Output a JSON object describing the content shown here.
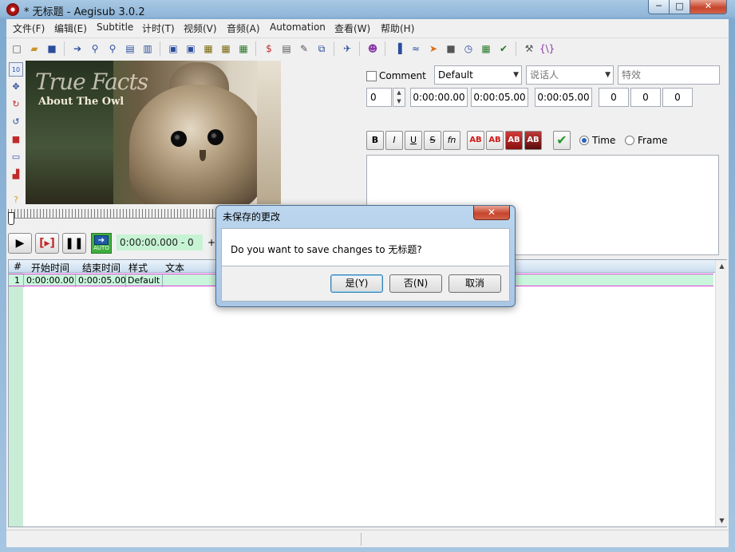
{
  "window": {
    "title": "* 无标题 - Aegisub 3.0.2",
    "min_glyph": "─",
    "max_glyph": "□",
    "close_glyph": "✕"
  },
  "menu": [
    "文件(F)",
    "编辑(E)",
    "Subtitle",
    "计时(T)",
    "视频(V)",
    "音频(A)",
    "Automation",
    "查看(W)",
    "帮助(H)"
  ],
  "video": {
    "title": "True Facts",
    "subtitle": "About The Owl"
  },
  "playback": {
    "time": "0:00:00.000 - 0",
    "auto_label": "AUTO",
    "plus_label": "+"
  },
  "edit": {
    "comment_label": "Comment",
    "style_value": "Default",
    "actor_placeholder": "说话人",
    "effect_placeholder": "特效",
    "layer_value": "0",
    "start_time": "0:00:00.00",
    "end_time": "0:00:05.00",
    "duration": "0:00:05.00",
    "margin_l": "0",
    "margin_r": "0",
    "margin_v": "0",
    "bold": "B",
    "italic": "I",
    "underline": "U",
    "strike": "S",
    "fn": "fn",
    "color_labels": [
      "AB",
      "AB",
      "AB",
      "AB"
    ],
    "time_label": "Time",
    "frame_label": "Frame"
  },
  "grid": {
    "headers": [
      "#",
      "开始时间",
      "结束时间",
      "样式",
      "文本"
    ],
    "rows": [
      {
        "num": "1",
        "start": "0:00:00.00",
        "end": "0:00:05.00",
        "style": "Default",
        "text": ""
      }
    ]
  },
  "dialog": {
    "title": "未保存的更改",
    "message": "Do you want to save changes to 无标题?",
    "yes_label": "是(Y)",
    "no_label": "否(N)",
    "cancel_label": "取消"
  },
  "colors": {
    "time_field_bg": "#c6f3d3",
    "grid_row_bg": "#c9f5dc",
    "grid_row_border": "#e040d8",
    "close_button": "#c7452c"
  }
}
